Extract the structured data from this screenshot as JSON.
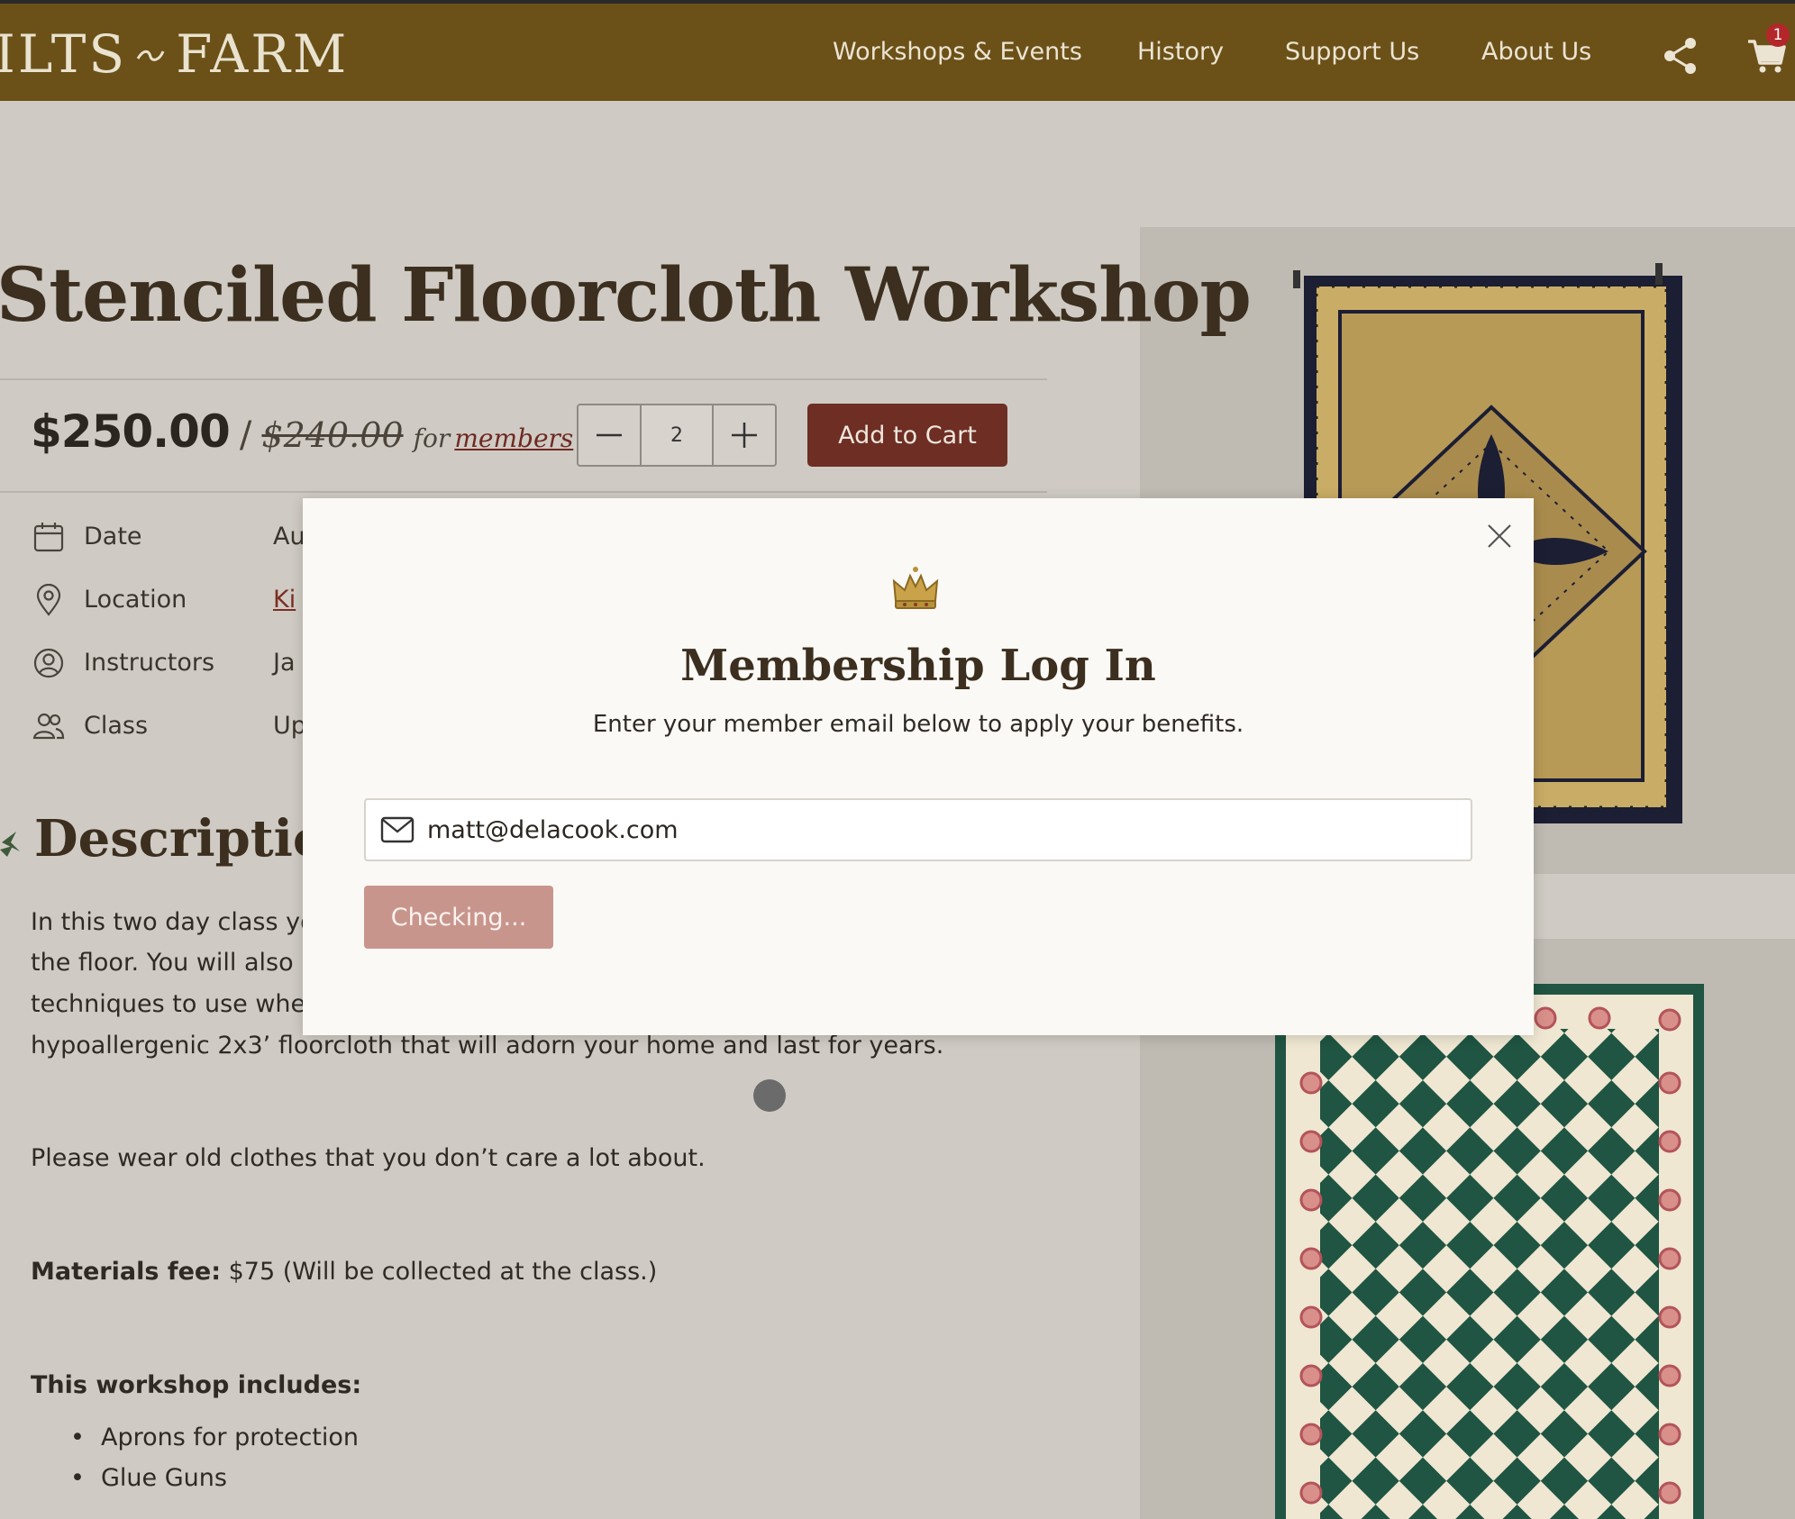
{
  "header": {
    "logo": "ILTS",
    "logo_word": "FARM",
    "nav": [
      {
        "label": "Workshops & Events"
      },
      {
        "label": "History"
      },
      {
        "label": "Support Us"
      },
      {
        "label": "About Us"
      }
    ],
    "cart_count": "1",
    "icons": {
      "share": "share-icon",
      "cart": "cart-icon"
    }
  },
  "product": {
    "title": "Stenciled Floorcloth Workshop",
    "price": "$250.00",
    "price_separator": "/",
    "member_price": "$240.00",
    "member_for": "for",
    "member_link": "members",
    "quantity": "2",
    "add_to_cart": "Add to Cart"
  },
  "details": [
    {
      "label": "Date",
      "value": "Au",
      "icon": "calendar-icon"
    },
    {
      "label": "Location",
      "value": "Ki",
      "icon": "location-pin-icon"
    },
    {
      "label": "Instructors",
      "value": "Ja",
      "icon": "user-circle-icon"
    },
    {
      "label": "Class",
      "value": "Up",
      "icon": "users-icon"
    }
  ],
  "description": {
    "heading": "Description",
    "lines": [
      "In this two day class yo",
      "the floor.  You will also",
      "techniques to use wher",
      "hypoallergenic 2x3’ floorcloth that will adorn your home and last for years."
    ],
    "note": "Please wear old clothes that you don’t care a lot about.",
    "materials_label": "Materials fee:",
    "materials_text": " $75 (Will be collected at the class.)",
    "includes_label": "This workshop includes:",
    "includes": [
      "Aprons for protection",
      "Glue Guns"
    ]
  },
  "modal": {
    "title": "Membership Log In",
    "subtitle": "Enter your member email below to apply your benefits.",
    "email_value": "matt@delacook.com",
    "button_label": "Checking...",
    "icons": {
      "close": "close-icon",
      "crown": "crown-icon",
      "mail": "mail-icon"
    }
  },
  "colors": {
    "header_bg": "#6b5118",
    "accent_red": "#6e2e24",
    "checking_button": "#c8958d",
    "page_bg": "#cfcbc4"
  }
}
